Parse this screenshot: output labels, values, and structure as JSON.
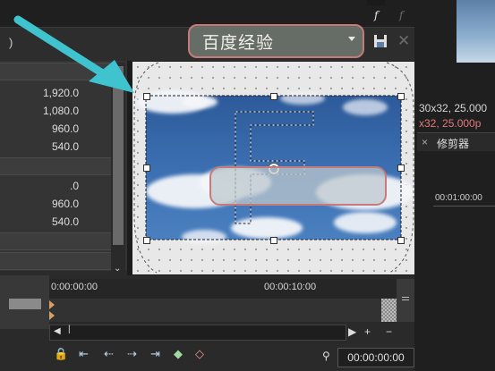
{
  "header": {
    "paren": ")",
    "watermark_text": "百度经验",
    "fx_label": "f",
    "fx2_label": "f"
  },
  "properties": {
    "group1": [
      "1,920.0",
      "1,080.0",
      "960.0",
      "540.0"
    ],
    "group2": [
      ".0",
      "960.0",
      "540.0"
    ]
  },
  "timeline": {
    "ruler_start": "0:00:00:00",
    "ruler_mid": "00:00:10:00",
    "timecode": "00:00:00:00",
    "plus": "+",
    "minus": "−"
  },
  "right_panel": {
    "info_line1": "30x32, 25.000",
    "info_line2": "x32, 25.000p",
    "tab_label": "修剪器",
    "tab_close": "×",
    "time_readout": "00:01:00:00"
  },
  "colors": {
    "annotation_arrow": "#3fc3cf",
    "highlight_border": "#c77a7a",
    "info_red": "#e07a7a"
  }
}
